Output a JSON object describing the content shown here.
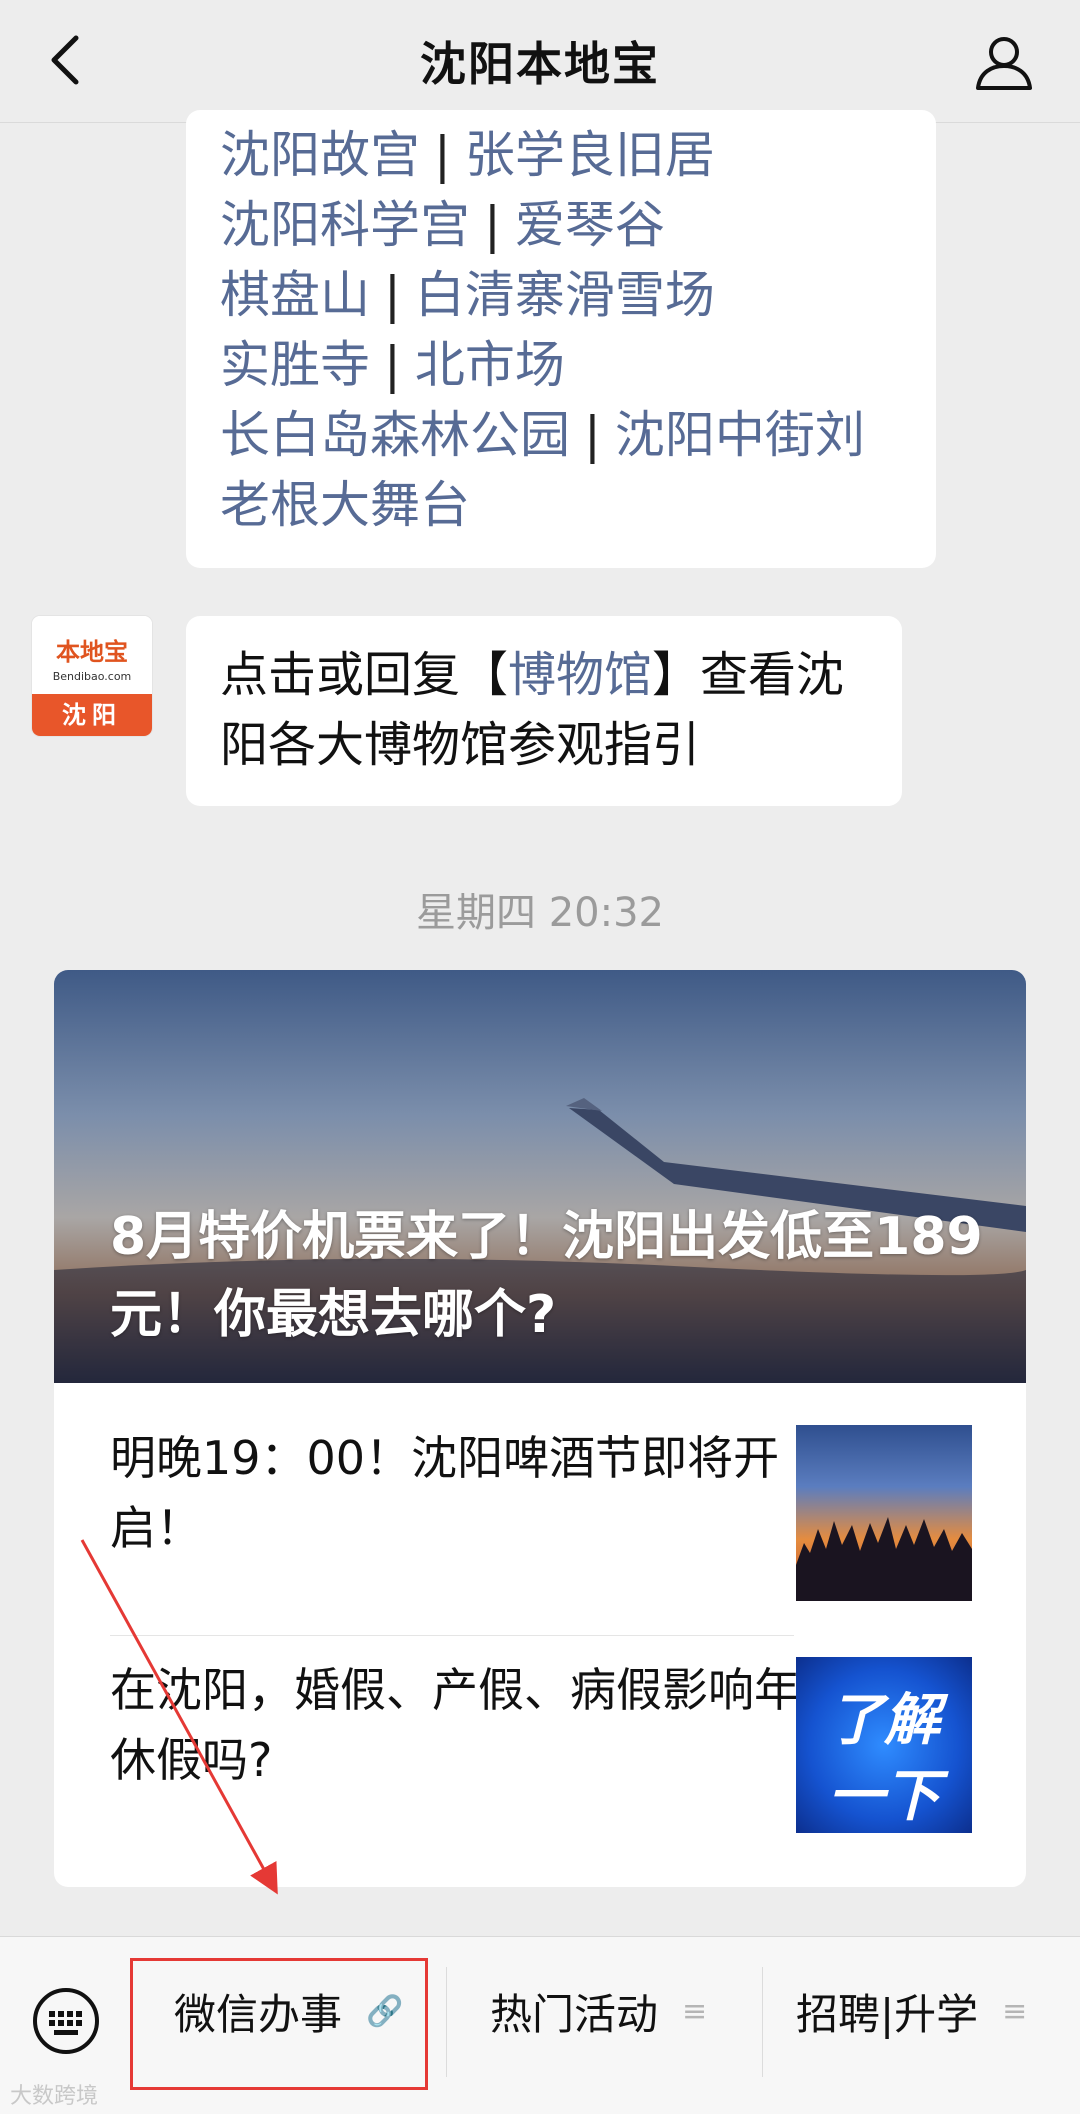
{
  "header": {
    "title": "沈阳本地宝"
  },
  "links": [
    [
      "沈阳故宫",
      "张学良旧居"
    ],
    [
      "沈阳科学宫",
      "爱琴谷"
    ],
    [
      "棋盘山",
      "白清寨滑雪场"
    ],
    [
      "实胜寺",
      "北市场"
    ],
    [
      "长白岛森林公园",
      "沈阳中街刘"
    ],
    [
      "老根大舞台"
    ]
  ],
  "separator": "|",
  "avatar": {
    "logo": "本地宝",
    "sub": "Bendibao.com",
    "city": "沈阳"
  },
  "reply": {
    "before": "点击或回复【",
    "keyword": "博物馆",
    "after": "】查看沈阳各大博物馆参观指引"
  },
  "timestamp": "星期四 20:32",
  "article": {
    "hero_title": "8月特价机票来了！沈阳出发低至189元！你最想去哪个?",
    "items": [
      {
        "title": "明晚19：00！沈阳啤酒节即将开启！"
      },
      {
        "title": "在沈阳，婚假、产假、病假影响年休假吗?",
        "thumb_text_1": "了解",
        "thumb_text_2": "一下"
      }
    ]
  },
  "menu": {
    "items": [
      {
        "label": "微信办事",
        "icon": "link-icon"
      },
      {
        "label": "热门活动",
        "icon": "list-icon"
      },
      {
        "label": "招聘|升学",
        "icon": "list-icon"
      }
    ]
  },
  "watermark": "大数跨境",
  "colors": {
    "link": "#576b95",
    "annotation": "#e53935"
  }
}
